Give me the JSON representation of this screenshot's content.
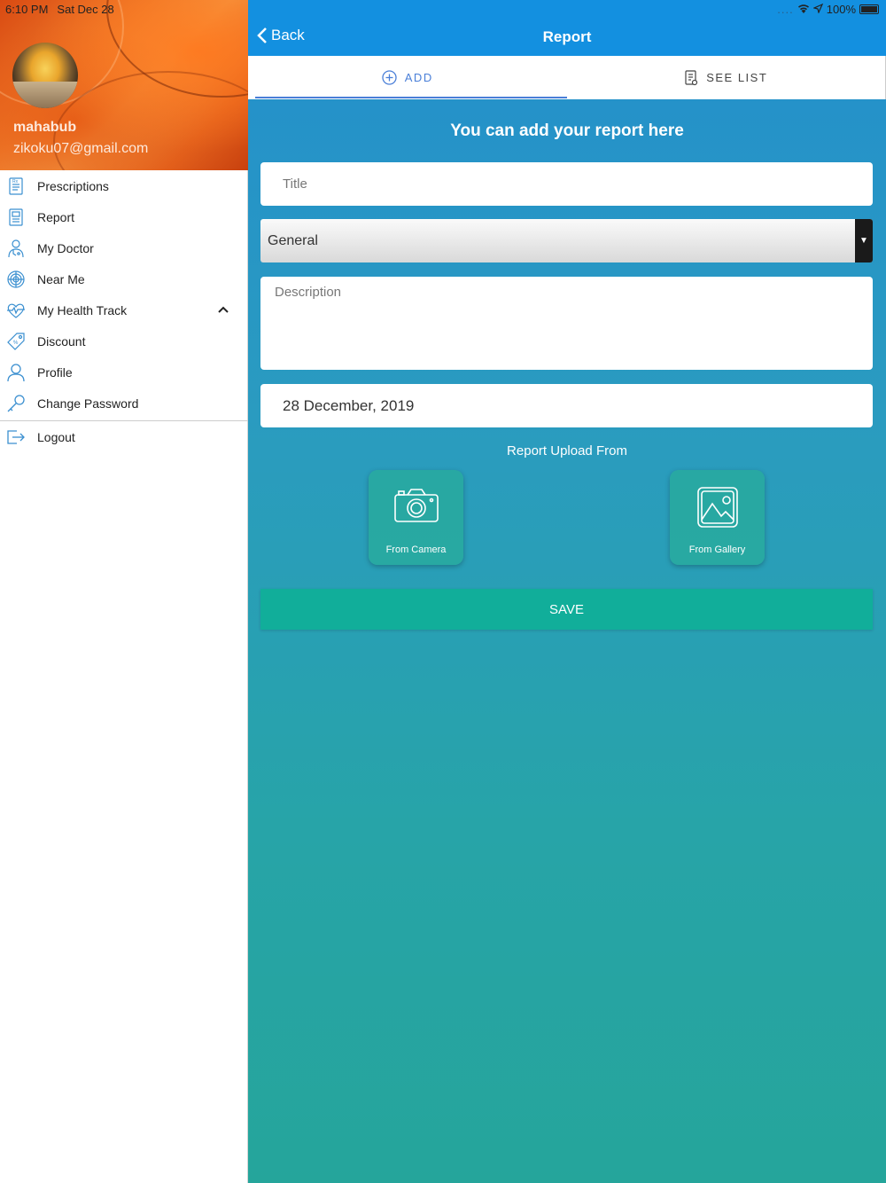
{
  "status_bar": {
    "time": "6:10 PM",
    "date": "Sat Dec 28",
    "signal": "....",
    "battery": "100%"
  },
  "profile": {
    "name": "mahabub",
    "email": "zikoku07@gmail.com"
  },
  "menu": {
    "items": [
      {
        "label": "Prescriptions",
        "icon": "prescription-icon"
      },
      {
        "label": "Report",
        "icon": "report-icon"
      },
      {
        "label": "My Doctor",
        "icon": "doctor-icon"
      },
      {
        "label": "Near Me",
        "icon": "radar-icon"
      },
      {
        "label": "My Health Track",
        "icon": "heartbeat-icon"
      },
      {
        "label": "Discount",
        "icon": "tag-icon"
      },
      {
        "label": "Profile",
        "icon": "person-icon"
      },
      {
        "label": "Change Password",
        "icon": "key-icon"
      }
    ],
    "logout": "Logout"
  },
  "header": {
    "back_label": "Back",
    "title": "Report"
  },
  "tabs": [
    {
      "label": "ADD",
      "active": true
    },
    {
      "label": "SEE LIST",
      "active": false
    }
  ],
  "form": {
    "headline": "You can add your report here",
    "title_placeholder": "Title",
    "category_value": "General",
    "description_placeholder": "Description",
    "date_value": "28 December, 2019",
    "upload_label": "Report Upload From",
    "camera_label": "From Camera",
    "gallery_label": "From Gallery",
    "save_label": "SAVE"
  },
  "colors": {
    "topbar": "#1390e0",
    "accent_tab": "#4a7fd8",
    "save_button": "#11ae9a",
    "icon_blue": "#3a8fd0"
  }
}
